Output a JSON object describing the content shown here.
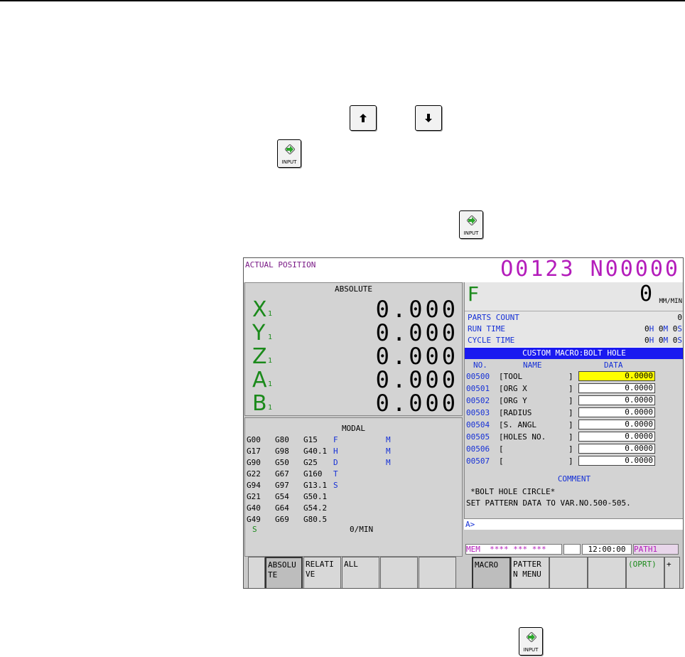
{
  "keys": {
    "input_label": "INPUT"
  },
  "screen": {
    "title": "ACTUAL POSITION",
    "program": "O0123 N00000",
    "absolute": {
      "header": "ABSOLUTE",
      "axes": [
        {
          "letter": "X",
          "sub": "1",
          "value": "0.000"
        },
        {
          "letter": "Y",
          "sub": "1",
          "value": "0.000"
        },
        {
          "letter": "Z",
          "sub": "1",
          "value": "0.000"
        },
        {
          "letter": "A",
          "sub": "1",
          "value": "0.000"
        },
        {
          "letter": "B",
          "sub": "1",
          "value": "0.000"
        }
      ]
    },
    "modal": {
      "header": "MODAL",
      "rows": [
        [
          "G00",
          "G80",
          "G15"
        ],
        [
          "G17",
          "G98",
          "G40.1"
        ],
        [
          "G90",
          "G50",
          "G25"
        ],
        [
          "G22",
          "G67",
          "G160"
        ],
        [
          "G94",
          "G97",
          "G13.1"
        ],
        [
          "G21",
          "G54",
          "G50.1"
        ],
        [
          "G40",
          "G64",
          "G54.2"
        ],
        [
          "G49",
          "G69",
          "G80.5"
        ]
      ],
      "codes": [
        "F",
        "H",
        "D",
        "T",
        "S"
      ],
      "m_codes": [
        "M",
        "M",
        "M"
      ],
      "speed_label": "S",
      "speed_value": "0/MIN"
    },
    "feed": {
      "letter": "F",
      "value": "0",
      "unit": "MM/MIN"
    },
    "info": {
      "parts_count_label": "PARTS COUNT",
      "parts_count_value": "0",
      "run_time_label": "RUN TIME",
      "run_h": "0",
      "run_m": "0",
      "run_s": "0",
      "cycle_time_label": "CYCLE TIME",
      "cyc_h": "0",
      "cyc_m": "0",
      "cyc_s": "0",
      "h": "H",
      "m": "M",
      "s": "S"
    },
    "macro": {
      "title": "CUSTOM MACRO:BOLT HOLE",
      "col_no": "NO.",
      "col_name": "NAME",
      "col_data": "DATA",
      "rows": [
        {
          "no": "00500",
          "name": "[TOOL",
          "value": "0.0000"
        },
        {
          "no": "00501",
          "name": "[ORG X",
          "value": "0.0000"
        },
        {
          "no": "00502",
          "name": "[ORG Y",
          "value": "0.0000"
        },
        {
          "no": "00503",
          "name": "[RADIUS",
          "value": "0.0000"
        },
        {
          "no": "00504",
          "name": "[S. ANGL",
          "value": "0.0000"
        },
        {
          "no": "00505",
          "name": "[HOLES NO.",
          "value": "0.0000"
        },
        {
          "no": "00506",
          "name": "[",
          "value": "0.0000"
        },
        {
          "no": "00507",
          "name": "[",
          "value": "0.0000"
        }
      ],
      "bracket_close": "]",
      "comment_header": "COMMENT",
      "comment_line1": "*BOLT HOLE CIRCLE*",
      "comment_line2": "SET PATTERN DATA TO VAR.NO.500-505."
    },
    "cmd_prompt": "A>",
    "status": {
      "mode": "MEM",
      "stars": "**** *** ***",
      "time": "12:00:00",
      "path": "PATH1"
    },
    "softkeys": {
      "absolute": "ABSOLU\nTE",
      "relative": "RELATI\nVE",
      "all": "ALL",
      "macro": "MACRO",
      "pattern_menu": "PATTER\nN MENU",
      "oprt": "(OPRT)",
      "next": "+"
    }
  }
}
